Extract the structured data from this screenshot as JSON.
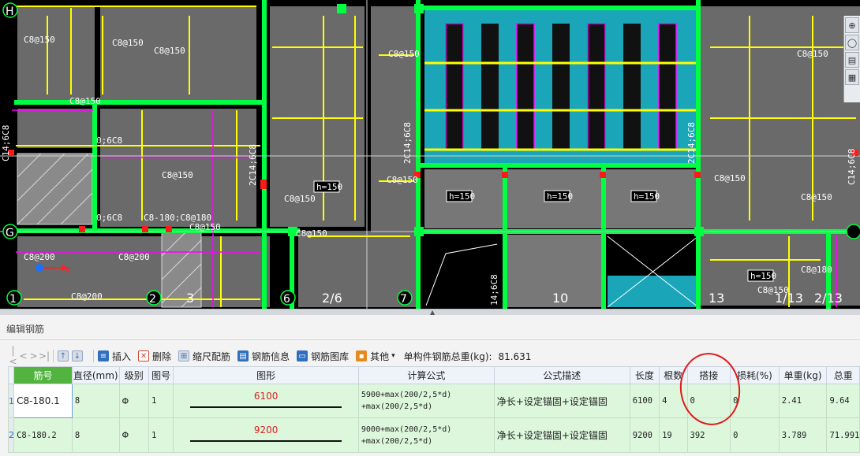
{
  "cad": {
    "axis_labels": [
      "H",
      "G",
      "1",
      "2",
      "3",
      "6",
      "2/6",
      "7",
      "10",
      "13",
      "1/13",
      "2/13"
    ],
    "annotations": [
      "C8@150",
      "C8@200",
      "C8@180",
      "2C14;6C8",
      "0;6C8",
      "h=150",
      "14;6C8",
      "C8-180;C8@180",
      "C14;6C8"
    ],
    "colors": {
      "background": "#000000",
      "wall": "#6a6a6a",
      "rebar_yellow": "#ffff00",
      "rebar_green": "#00ff40",
      "beam_magenta": "#ff00ff",
      "stair_cyan": "#1aa6b8"
    }
  },
  "side_tools": [
    "zoom-icon",
    "rotate-icon",
    "layer-icon",
    "grid-icon"
  ],
  "panel": {
    "title": "编辑钢筋",
    "toolbar": {
      "nav": [
        "|<",
        "<",
        ">",
        ">|"
      ],
      "insert": "插入",
      "delete": "删除",
      "scale_rebar": "缩尺配筋",
      "rebar_info": "钢筋信息",
      "rebar_library": "钢筋图库",
      "other": "其他",
      "total_weight_label": "单构件钢筋总重(kg):",
      "total_weight_value": "81.631"
    },
    "columns": [
      "筋号",
      "直径(mm)",
      "级别",
      "图号",
      "图形",
      "计算公式",
      "公式描述",
      "长度",
      "根数",
      "搭接",
      "损耗(%)",
      "单重(kg)",
      "总重"
    ],
    "rows": [
      {
        "row_no": "1",
        "name": "C8-180.1",
        "diameter": "8",
        "grade": "Φ",
        "figure_no": "1",
        "shape_length": "6100",
        "formula_line1": "5900+max(200/2,5*d)",
        "formula_line2": "+max(200/2,5*d)",
        "description": "净长+设定锚固+设定锚固",
        "length": "6100",
        "count": "4",
        "lap": "0",
        "loss": "0",
        "unit_weight": "2.41",
        "total_weight": "9.64"
      },
      {
        "row_no": "2",
        "name": "C8-180.2",
        "diameter": "8",
        "grade": "Φ",
        "figure_no": "1",
        "shape_length": "9200",
        "formula_line1": "9000+max(200/2,5*d)",
        "formula_line2": "+max(200/2,5*d)",
        "description": "净长+设定锚固+设定锚固",
        "length": "9200",
        "count": "19",
        "lap": "392",
        "loss": "0",
        "unit_weight": "3.789",
        "total_weight": "71.991"
      }
    ]
  }
}
